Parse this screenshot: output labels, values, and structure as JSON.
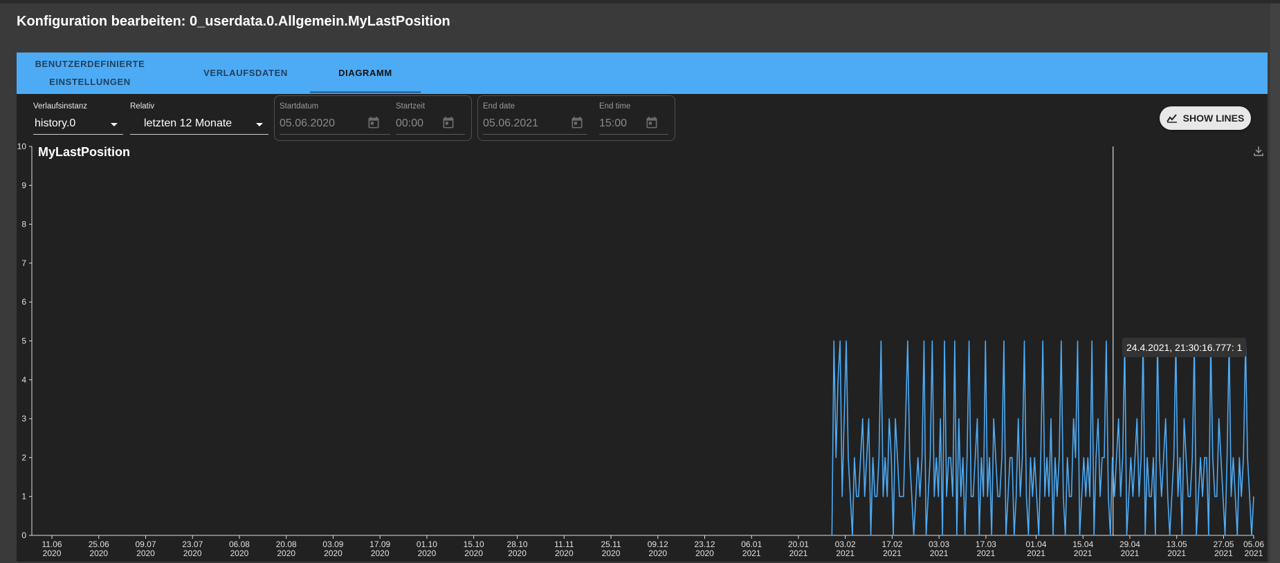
{
  "dialog": {
    "title": "Konfiguration bearbeiten: 0_userdata.0.Allgemein.MyLastPosition"
  },
  "tabs": [
    {
      "line1": "BENUTZERDEFINIERTE",
      "line2": "EINSTELLUNGEN"
    },
    {
      "label": "VERLAUFSDATEN"
    },
    {
      "label": "DIAGRAMM"
    }
  ],
  "active_tab": "DIAGRAMM",
  "controls": {
    "instance": {
      "label": "Verlaufsinstanz",
      "value": "history.0"
    },
    "relative": {
      "label": "Relativ",
      "value": "letzten 12 Monate"
    },
    "start_date": {
      "label": "Startdatum",
      "value": "05.06.2020"
    },
    "start_time": {
      "label": "Startzeit",
      "value": "00:00"
    },
    "end_date": {
      "label": "End date",
      "value": "05.06.2021"
    },
    "end_time": {
      "label": "End time",
      "value": "15:00"
    },
    "show_lines": {
      "label": "SHOW LINES",
      "icon": "chart-line-icon"
    }
  },
  "download_icon": "download-icon",
  "calendar_icon": "calendar-icon",
  "tooltip": {
    "text": "24.4.2021, 21:30:16.777: 1"
  },
  "chart_data": {
    "type": "line",
    "title": "MyLastPosition",
    "color": "#4dabf5",
    "ylim": [
      0,
      10
    ],
    "y_ticks": [
      "0",
      "1",
      "2",
      "3",
      "4",
      "5",
      "6",
      "7",
      "8",
      "9",
      "10"
    ],
    "x_ticks": [
      [
        "11.06",
        "2020"
      ],
      [
        "25.06",
        "2020"
      ],
      [
        "09.07",
        "2020"
      ],
      [
        "23.07",
        "2020"
      ],
      [
        "06.08",
        "2020"
      ],
      [
        "20.08",
        "2020"
      ],
      [
        "03.09",
        "2020"
      ],
      [
        "17.09",
        "2020"
      ],
      [
        "01.10",
        "2020"
      ],
      [
        "15.10",
        "2020"
      ],
      [
        "28.10",
        "2020"
      ],
      [
        "11.11",
        "2020"
      ],
      [
        "25.11",
        "2020"
      ],
      [
        "09.12",
        "2020"
      ],
      [
        "23.12",
        "2020"
      ],
      [
        "06.01",
        "2021"
      ],
      [
        "20.01",
        "2021"
      ],
      [
        "03.02",
        "2021"
      ],
      [
        "17.02",
        "2021"
      ],
      [
        "03.03",
        "2021"
      ],
      [
        "17.03",
        "2021"
      ],
      [
        "01.04",
        "2021"
      ],
      [
        "15.04",
        "2021"
      ],
      [
        "29.04",
        "2021"
      ],
      [
        "13.05",
        "2021"
      ],
      [
        "27.05",
        "2021"
      ],
      [
        "05.06",
        "2021"
      ]
    ],
    "x_start": "2020-06-05",
    "x_end": "2021-06-05",
    "crosshair_x": "2021-04-24",
    "series": [
      {
        "start": "2021-01-30",
        "end": "2021-06-05",
        "values": [
          0,
          5,
          2,
          4,
          5,
          1,
          3,
          5,
          2,
          1,
          0,
          2,
          1,
          1,
          2,
          3,
          1,
          2,
          3,
          0,
          2,
          1,
          1,
          2,
          5,
          1,
          2,
          1,
          3,
          2,
          0,
          3,
          2,
          1,
          1,
          1,
          3,
          5,
          2,
          1,
          0,
          1,
          2,
          1,
          2,
          5,
          0,
          1,
          2,
          5,
          1,
          2,
          1,
          3,
          0,
          5,
          1,
          2,
          2,
          1,
          5,
          0,
          3,
          1,
          2,
          0,
          2,
          5,
          1,
          1,
          2,
          3,
          0,
          2,
          1,
          5,
          1,
          2,
          0,
          3,
          2,
          1,
          1,
          2,
          5,
          0,
          1,
          2,
          2,
          0,
          1,
          3,
          1,
          2,
          5,
          1,
          0,
          2,
          1,
          2,
          1,
          0,
          2,
          5,
          1,
          2,
          1,
          3,
          0,
          2,
          1,
          2,
          5,
          1,
          0,
          2,
          1,
          1,
          3,
          2,
          5,
          0,
          1,
          2,
          1,
          2,
          1,
          5,
          0,
          2,
          3,
          1,
          2,
          2,
          5,
          1,
          0,
          2,
          1,
          2,
          3,
          1,
          2,
          5,
          0,
          1,
          2,
          1,
          2,
          3,
          1,
          2,
          5,
          0,
          2,
          1,
          1,
          2,
          0,
          5,
          2,
          1,
          2,
          3,
          1,
          0,
          1,
          2,
          5,
          1,
          2,
          0,
          3,
          2,
          1,
          1,
          2,
          5,
          0,
          1,
          2,
          1,
          2,
          2,
          0,
          5,
          2,
          1,
          1,
          3,
          2,
          1,
          0,
          2,
          5,
          1,
          2,
          1,
          0,
          2,
          1,
          2,
          5,
          2,
          1,
          0,
          1
        ]
      }
    ]
  }
}
